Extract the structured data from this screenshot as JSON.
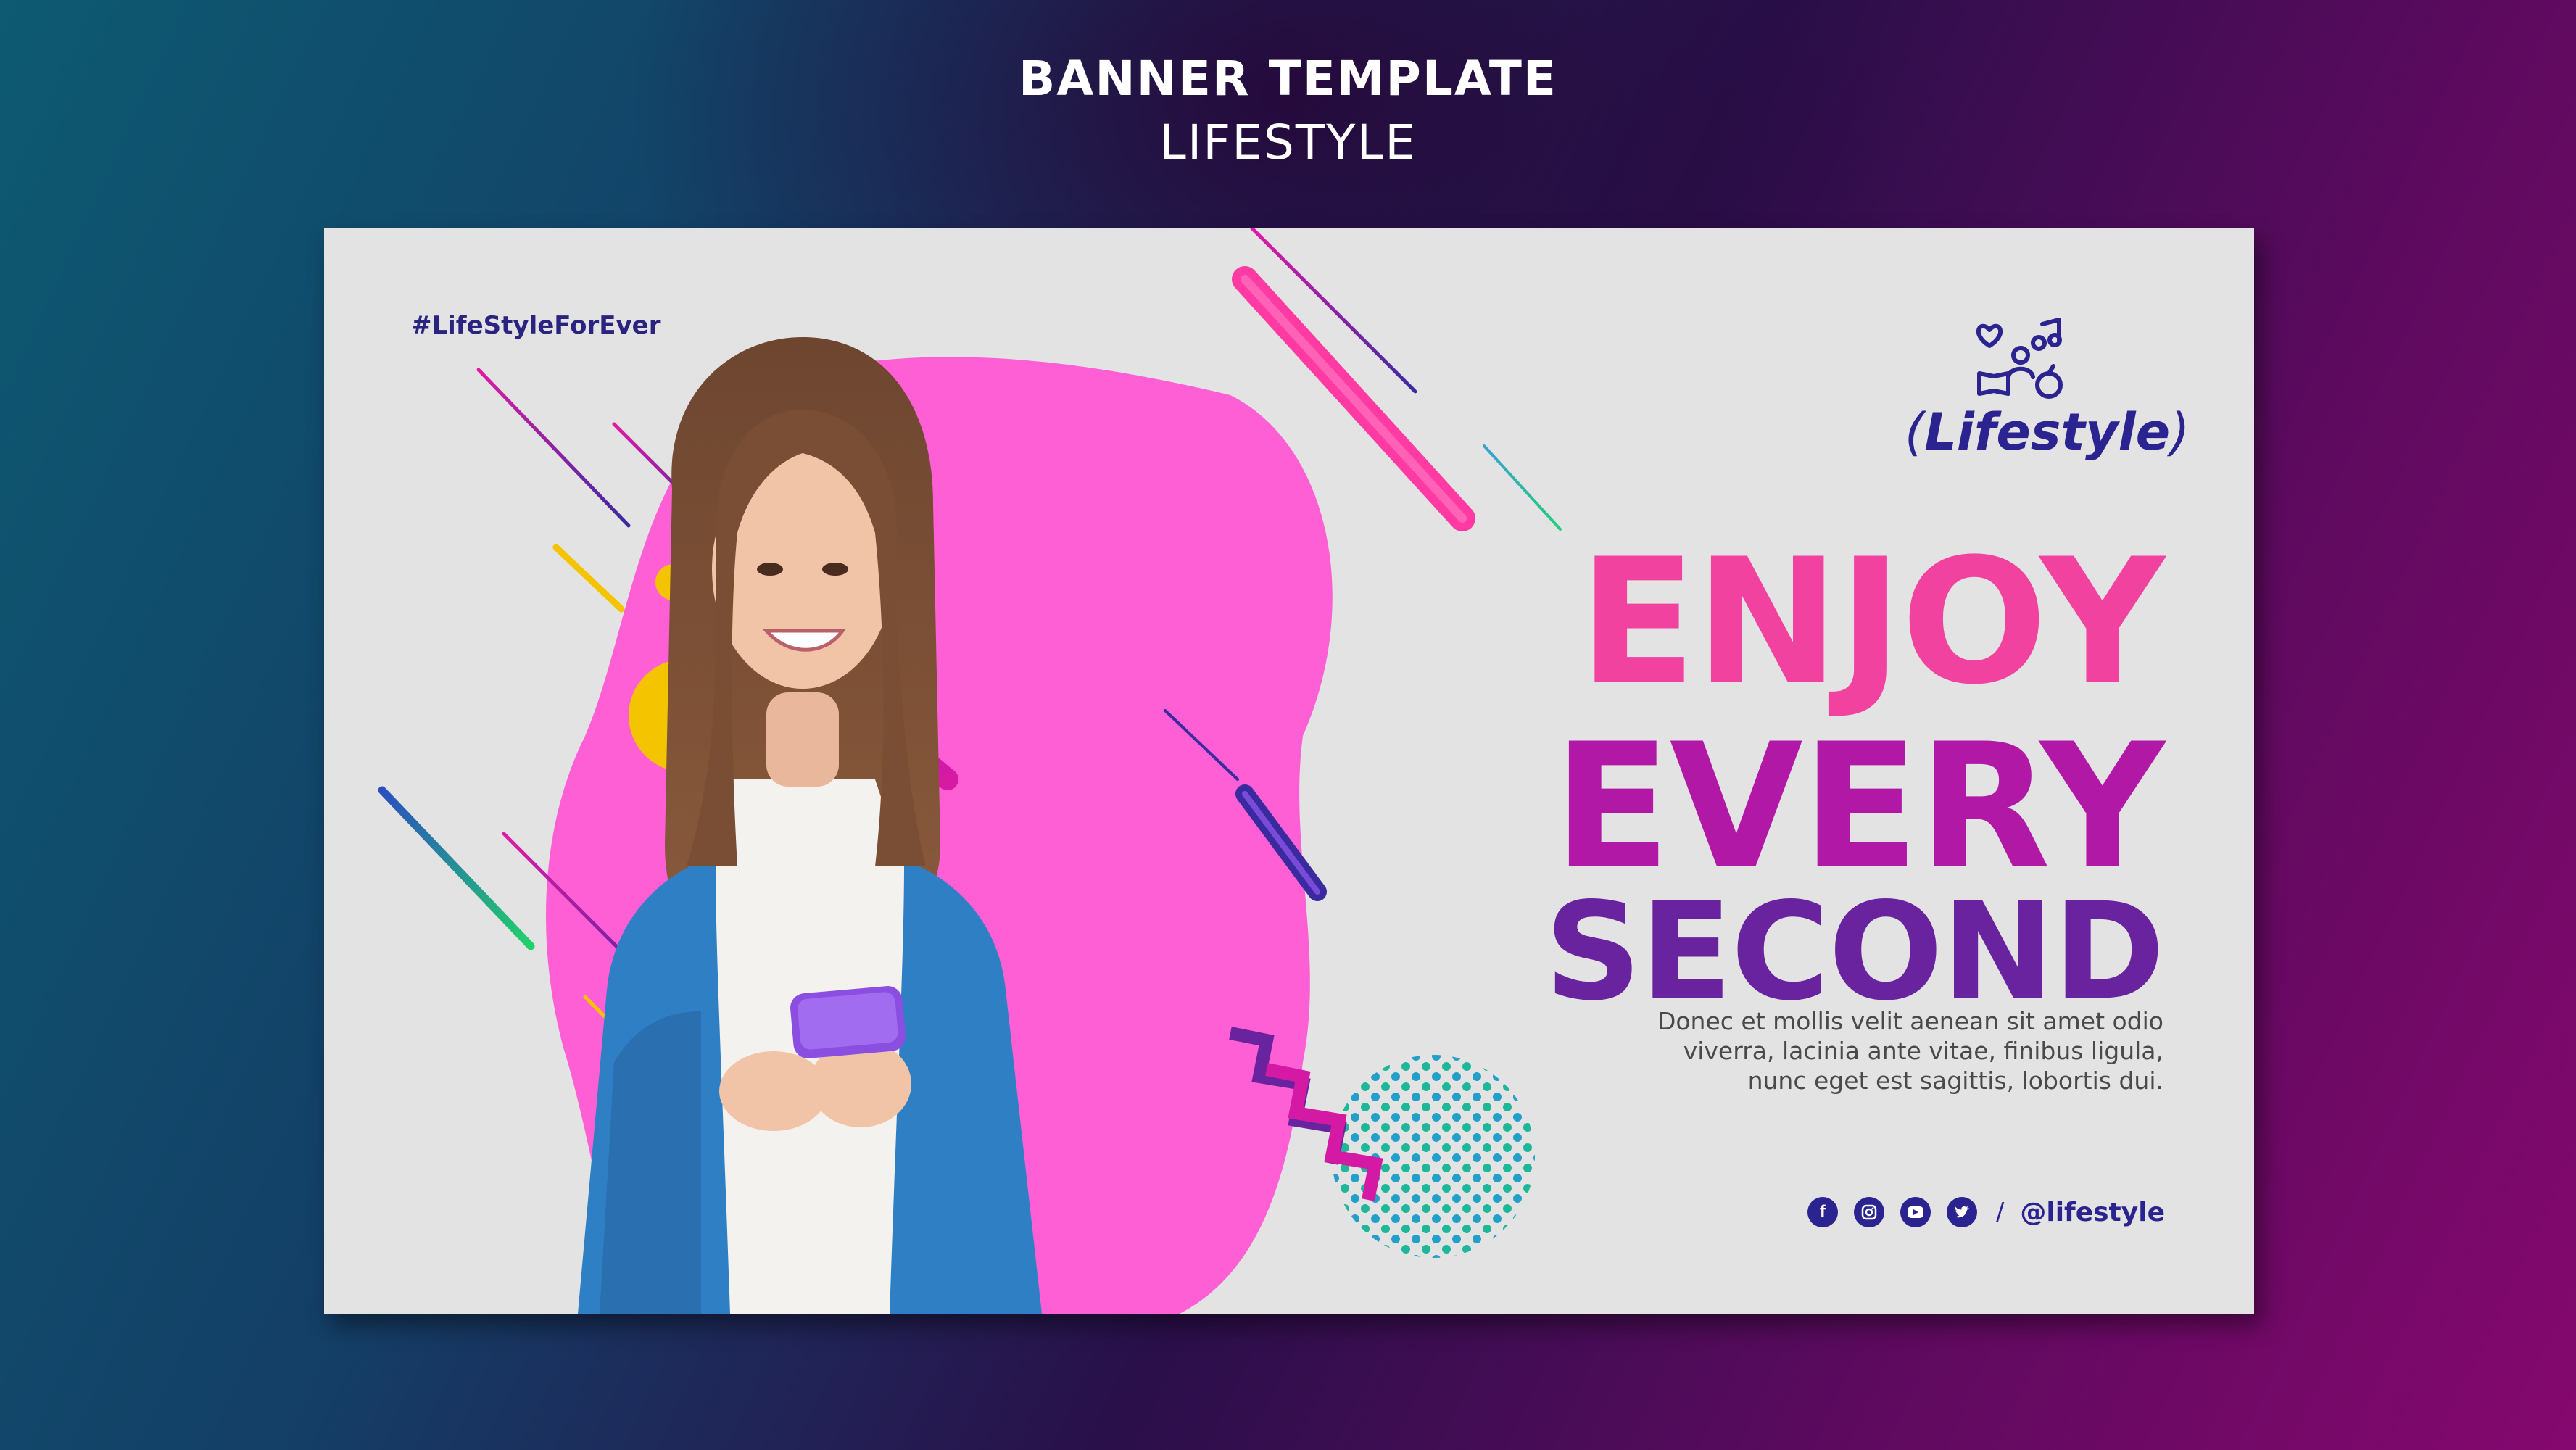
{
  "header": {
    "title": "BANNER TEMPLATE",
    "subtitle": "LIFESTYLE"
  },
  "banner": {
    "hashtag": "#LifeStyleForEver",
    "logo": {
      "icon": "lifestyle-icons-icon",
      "text": "Lifestyle"
    },
    "headline": {
      "line1": "ENJOY",
      "line2": "EVERY",
      "line3": "SECOND"
    },
    "body": "Donec et mollis velit aenean sit amet odio viverra, lacinia ante vitae, finibus ligula, nunc eget est sagittis, lobortis dui.",
    "social": {
      "icons": [
        "facebook-icon",
        "instagram-icon",
        "youtube-icon",
        "twitter-icon"
      ],
      "separator": "/",
      "handle": "@lifestyle"
    },
    "photo": "woman-holding-phone"
  },
  "colors": {
    "pink": "#f2429f",
    "magenta": "#b218a6",
    "purple": "#6a239e",
    "navy": "#2b2390",
    "banner_bg": "#e3e3e3"
  }
}
